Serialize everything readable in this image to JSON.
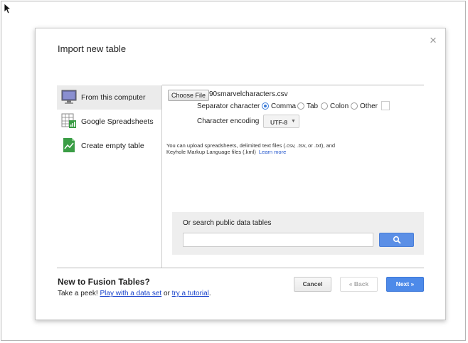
{
  "dialog": {
    "title": "Import new table",
    "close_glyph": "×"
  },
  "sources": [
    {
      "label": "From this computer",
      "icon": "computer-icon"
    },
    {
      "label": "Google Spreadsheets",
      "icon": "spreadsheet-icon"
    },
    {
      "label": "Create empty table",
      "icon": "empty-table-icon"
    }
  ],
  "upload": {
    "choose_file_label": "Choose File",
    "file_name": "90smarvelcharacters.csv",
    "separator_label": "Separator character",
    "separators": [
      {
        "label": "Comma",
        "checked": true
      },
      {
        "label": "Tab",
        "checked": false
      },
      {
        "label": "Colon",
        "checked": false
      },
      {
        "label": "Other",
        "checked": false
      }
    ],
    "encoding_label": "Character encoding",
    "encoding_value": "UTF-8",
    "hint_line1": "You can upload spreadsheets, delimited text files (.csv, .tsv, or .txt), and",
    "hint_line2": "Keyhole Markup Language files (.kml)",
    "learn_more": "Learn more"
  },
  "search": {
    "label": "Or search public data tables",
    "value": "",
    "placeholder": ""
  },
  "footer": {
    "title": "New to Fusion Tables?",
    "text_prefix": "Take a peek! ",
    "link1": "Play with a data set",
    "text_mid": " or ",
    "link2": "try a tutorial",
    "text_suffix": "."
  },
  "buttons": {
    "cancel": "Cancel",
    "back": "« Back",
    "next": "Next »"
  },
  "colors": {
    "accent": "#4d8ae9",
    "link": "#1a44cc"
  }
}
